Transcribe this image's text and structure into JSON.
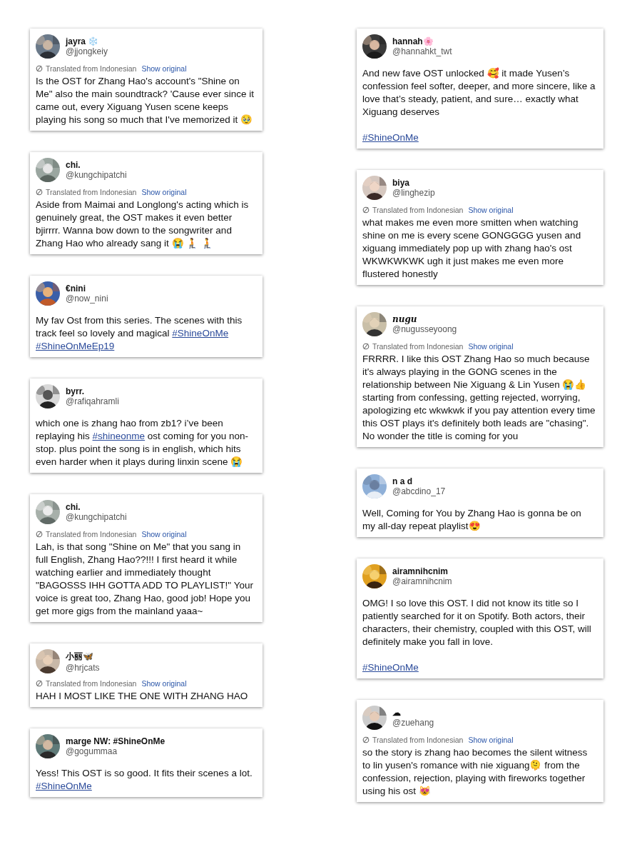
{
  "columns": [
    {
      "tweets": [
        {
          "name": "jayra ❄️",
          "handle": "@jjongkeiy",
          "translated": {
            "note": "Translated from Indonesian",
            "link": "Show original"
          },
          "paragraphs": [
            [
              {
                "kind": "text",
                "text": "Is the OST for Zhang Hao's account's \"Shine on Me\" also the main soundtrack? 'Cause ever since it came out, every Xiguang Yusen scene keeps playing his song so much that I've memorized it 🥹"
              }
            ]
          ]
        },
        {
          "name": "chi.",
          "handle": "@kungchipatchi",
          "translated": {
            "note": "Translated from Indonesian",
            "link": "Show original"
          },
          "paragraphs": [
            [
              {
                "kind": "text",
                "text": "Aside from Maimai and Longlong's acting which is genuinely great, the OST makes it even better bjirrrr. Wanna bow down to the songwriter and Zhang Hao who already sang it 😭 🧎 🧎"
              }
            ]
          ]
        },
        {
          "name": "€nini",
          "handle": "@now_nini",
          "paragraphs": [
            [
              {
                "kind": "text",
                "text": "My fav Ost from this series. The scenes with this track feel so lovely and magical "
              },
              {
                "kind": "hashtag",
                "text": "#ShineOnMe"
              },
              {
                "kind": "hashtag",
                "text": "#ShineOnMeEp19"
              }
            ]
          ]
        },
        {
          "name": "byrr.",
          "handle": "@rafiqahramli",
          "paragraphs": [
            [
              {
                "kind": "text",
                "text": "which one is zhang hao from zb1? i’ve been replaying his "
              },
              {
                "kind": "hashtag",
                "text": "#shineonme"
              },
              {
                "kind": "text",
                "text": " ost coming for you non-stop. plus point the song is in english, which hits even harder when it plays during linxin scene 😭"
              }
            ]
          ]
        },
        {
          "name": "chi.",
          "handle": "@kungchipatchi",
          "translated": {
            "note": "Translated from Indonesian",
            "link": "Show original"
          },
          "paragraphs": [
            [
              {
                "kind": "text",
                "text": "Lah, is that song \"Shine on Me\" that you sang in full English, Zhang Hao??!!! I first heard it while watching earlier and immediately thought \"BAGOSSS IHH GOTTA ADD TO PLAYLIST!\" Your voice is great too, Zhang Hao, good job! Hope you get more gigs from the mainland yaaa~"
              }
            ]
          ]
        },
        {
          "name": "小丽🦋",
          "handle": "@hrjcats",
          "translated": {
            "note": "Translated from Indonesian",
            "link": "Show original"
          },
          "paragraphs": [
            [
              {
                "kind": "text",
                "text": "HAH I MOST LIKE THE ONE WITH ZHANG HAO"
              }
            ]
          ]
        },
        {
          "name": "marge NW: #ShineOnMe",
          "handle": "@gogummaa",
          "paragraphs": [
            [
              {
                "kind": "text",
                "text": "Yess! This OST is so good. It fits their scenes a lot. "
              },
              {
                "kind": "hashtag",
                "text": "#ShineOnMe"
              }
            ]
          ]
        }
      ]
    },
    {
      "tweets": [
        {
          "name": "hannah🌸",
          "handle": "@hannahkt_twt",
          "paragraphs": [
            [
              {
                "kind": "text",
                "text": "And new fave OST unlocked 🥰 it made Yusen’s confession feel softer, deeper, and more sincere, like a love that’s steady, patient, and sure… exactly what Xiguang deserves"
              }
            ],
            [
              {
                "kind": "hashtag",
                "text": "#ShineOnMe"
              }
            ]
          ]
        },
        {
          "name": "biya",
          "handle": "@linghezip",
          "translated": {
            "note": "Translated from Indonesian",
            "link": "Show original"
          },
          "paragraphs": [
            [
              {
                "kind": "text",
                "text": "what makes me even more smitten when watching shine on me is every scene GONGGGG yusen and xiguang immediately pop up with zhang hao's ost WKWKWKWK ugh it just makes me even more flustered honestly"
              }
            ]
          ]
        },
        {
          "name": "𝒏𝒖𝒈𝒖",
          "handle": "@nugusseyoong",
          "translated": {
            "note": "Translated from Indonesian",
            "link": "Show original"
          },
          "paragraphs": [
            [
              {
                "kind": "text",
                "text": "FRRRR. I like this OST Zhang Hao so much because it's always playing in the GONG scenes in the relationship between Nie Xiguang & Lin Yusen 😭👍 starting from confessing, getting rejected, worrying, apologizing etc wkwkwk if you pay attention every time this OST plays it's definitely both leads are \"chasing\". No wonder the title is coming for you"
              }
            ]
          ]
        },
        {
          "name": "n a d",
          "handle": "@abcdino_17",
          "paragraphs": [
            [
              {
                "kind": "text",
                "text": "Well, Coming for You by Zhang Hao is gonna be on my all-day repeat playlist😍"
              }
            ]
          ]
        },
        {
          "name": "airamnihcnim",
          "handle": "@airamnihcnim",
          "paragraphs": [
            [
              {
                "kind": "text",
                "text": "OMG! I so love this OST. I did not know its title so I patiently searched for it on Spotify. Both actors, their characters, their chemistry, coupled with this OST, will definitely make you fall in love."
              }
            ],
            [
              {
                "kind": "hashtag",
                "text": "#ShineOnMe"
              }
            ]
          ]
        },
        {
          "name": "☁",
          "handle": "@zuehang",
          "translated": {
            "note": "Translated from Indonesian",
            "link": "Show original"
          },
          "paragraphs": [
            [
              {
                "kind": "text",
                "text": "so the story is zhang hao becomes the silent witness to lin yusen's romance with nie xiguang🫠 from the confession, rejection, playing with fireworks together using his ost 😻"
              }
            ]
          ]
        }
      ]
    }
  ]
}
